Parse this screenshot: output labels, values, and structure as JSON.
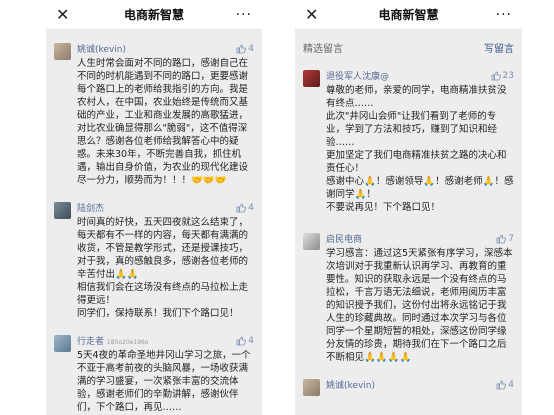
{
  "left": {
    "title": "电商新智慧",
    "close_icon": "✕",
    "more_icon": "···",
    "comments": [
      {
        "name": "姚诚(kevin)",
        "likes": "4",
        "text": "人生时常会面对不同的路口，感谢自己在不同的时机能遇到不同的路口，更要感谢每个路口上的老师给我指引的方向。我是农村人，在中国，农业始终是传统而又基础的产业，工业和商业发展的高歌猛进，对比农业确显得那么\"脆弱\"，这不值得深思么？感谢各位老师给我解答心中的疑惑。未来30年，不断完善自我，抓住机遇，输出自身价值，为农业的现代化建设尽一分力，顺势而为！！！🤝🤝🤝"
      },
      {
        "name": "陆剑杰",
        "likes": "4",
        "text": "时间真的好快，五天四夜就这么结束了，每天都有不一样的内容，每天都有满满的收货，不管是教学形式，还是授课技巧，对于我，真的感触良多，感谢各位老师的辛苦付出🙏🙏\n相信我们会在这场没有终点的马拉松上走得更远！\n同学们，保持联系！我们下个路口见！"
      },
      {
        "name": "行走者",
        "name_suffix": "185o20e196o",
        "likes": "4",
        "text": "5天4夜的革命圣地井冈山学习之旅，一个不亚于高考前夜的头脑风暴，一场收获满满的学习盛宴，一次紧张丰富的交流体验，感谢老师们的辛勤讲解，感谢伙伴们，下个路口，再见……"
      }
    ]
  },
  "right": {
    "title": "电商新智慧",
    "close_icon": "✕",
    "more_icon": "···",
    "section_label": "精选留言",
    "write_label": "写留言",
    "comments": [
      {
        "name": "退役军人沈康@",
        "likes": "23",
        "text": "尊敬的老师，亲爱的同学，电商精准扶贫没有终点……\n此次\"井冈山会师\"让我们看到了老师的专业，学到了方法和技巧，赚到了知识和经验……\n更加坚定了我们电商精准扶贫之路的决心和责任心！\n感谢中心🙏！感谢领导🙏！感谢老师🙏！感谢同学🙏！\n不要说再见！下个路口见！"
      },
      {
        "name": "启民电商",
        "likes": "7",
        "text": "学习感言：通过这5天紧张有序学习，深感本次培训对于我重新认识再学习、再教育的重要性。知识的获取永远是一个没有终点的马拉松，千言万语无法细说，老师用阅历丰富的知识授予我们，这份付出将永远铭记于我人生的珍藏典故。同时通过本次学习与各位同学一个星期短暂的相处，深感这份同学缘分友情的珍贵，期待我们在下一个路口之后不断相见🙏🙏🙏🙏"
      },
      {
        "name": "姚诚(kevin)",
        "likes": "4",
        "text": ""
      }
    ]
  },
  "colors": {
    "name": "#576b95",
    "like": "#7d8fb3",
    "background": "#ededed"
  }
}
